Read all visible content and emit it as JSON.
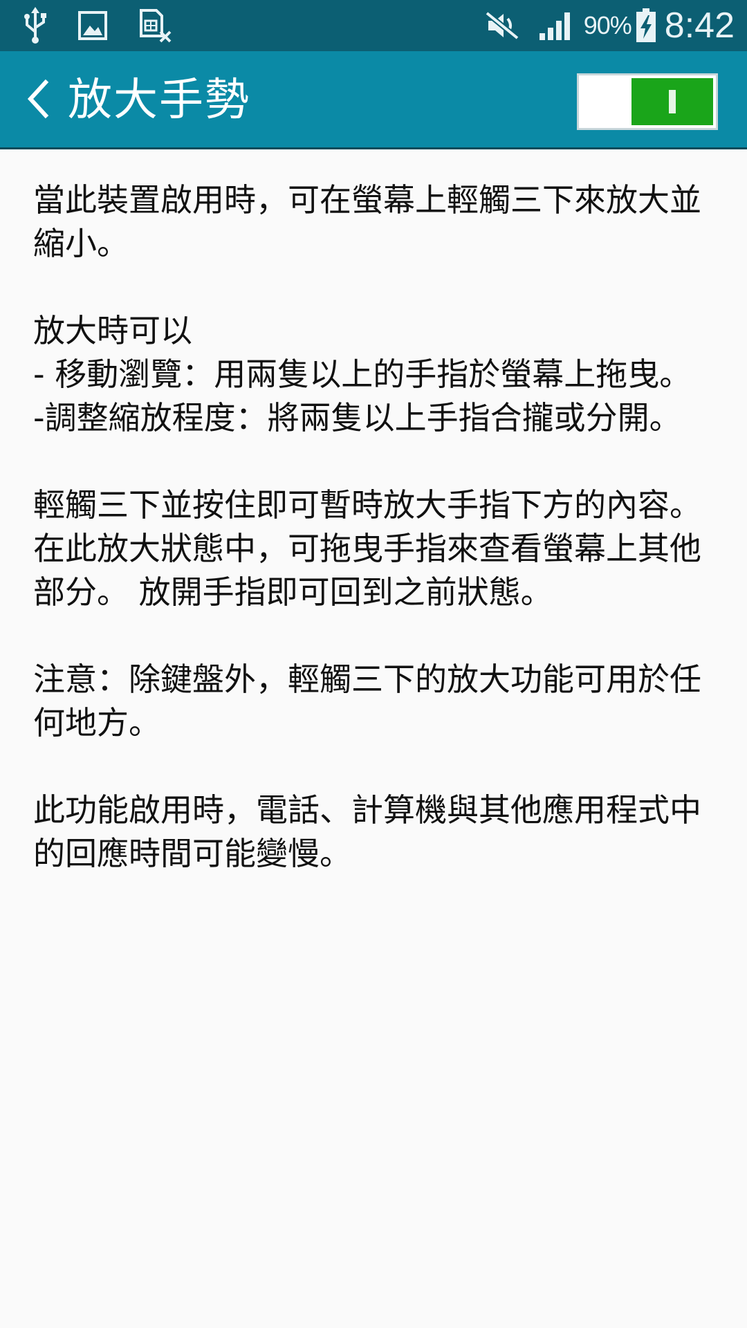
{
  "status_bar": {
    "icons": [
      "usb-icon",
      "image-icon",
      "sim-card-off-icon"
    ],
    "right_icons": [
      "mute-icon",
      "signal-icon",
      "battery-charging-icon"
    ],
    "battery_percent": "90%",
    "time": "8:42"
  },
  "app_bar": {
    "title": "放大手勢",
    "back_icon": "chevron-left-icon",
    "master_switch_on": true
  },
  "content": {
    "paragraphs": [
      "當此裝置啟用時，可在螢幕上輕觸三下來放大並縮小。",
      "放大時可以\n- 移動瀏覽：用兩隻以上的手指於螢幕上拖曳。\n-調整縮放程度：將兩隻以上手指合攏或分開。",
      "輕觸三下並按住即可暫時放大手指下方的內容。 在此放大狀態中，可拖曳手指來查看螢幕上其他部分。 放開手指即可回到之前狀態。",
      "注意：除鍵盤外，輕觸三下的放大功能可用於任何地方。",
      "此功能啟用時，電話、計算機與其他應用程式中的回應時間可能變慢。"
    ]
  },
  "colors": {
    "status_bar_bg": "#0c5f73",
    "app_bar_bg": "#0b8aa6",
    "switch_on": "#1aa51a",
    "page_bg": "#fafafa"
  }
}
